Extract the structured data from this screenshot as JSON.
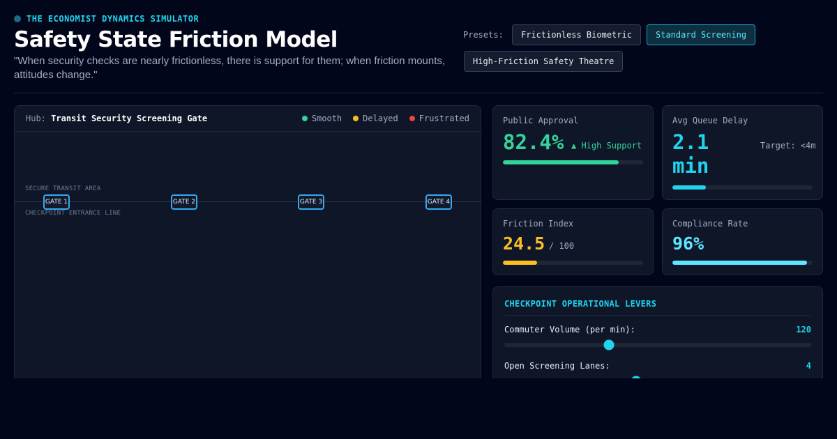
{
  "header": {
    "brand": "THE ECONOMIST DYNAMICS SIMULATOR",
    "title": "Safety State Friction Model",
    "quote": "\"When security checks are nearly frictionless, there is support for them; when friction mounts, attitudes change.\""
  },
  "presets": {
    "label": "Presets:",
    "items": [
      {
        "label": "Frictionless Biometric",
        "active": false
      },
      {
        "label": "Standard Screening",
        "active": true
      },
      {
        "label": "High-Friction Safety Theatre",
        "active": false
      }
    ]
  },
  "simulation": {
    "hub_prefix": "Hub:",
    "hub_name": "Transit Security Screening Gate",
    "legend": [
      {
        "label": "Smooth",
        "color": "#34d399"
      },
      {
        "label": "Delayed",
        "color": "#fbbf24"
      },
      {
        "label": "Frustrated",
        "color": "#ef4444"
      }
    ],
    "zone_top": "SECURE TRANSIT AREA",
    "zone_bottom": "CHECKPOINT ENTRANCE LINE",
    "gates": [
      "GATE 1",
      "GATE 2",
      "GATE 3",
      "GATE 4"
    ]
  },
  "metrics": {
    "approval": {
      "label": "Public Approval",
      "value": "82.4%",
      "aside": "▲ High Support",
      "fill": 0.824,
      "color": "#34d399"
    },
    "queue": {
      "label": "Avg Queue Delay",
      "value": "2.1 min",
      "aside": "Target: <4m",
      "fill": 0.24,
      "color": "#22d3ee"
    },
    "friction": {
      "label": "Friction Index",
      "value": "24.5",
      "aside": "/ 100",
      "fill": 0.245,
      "color": "#fbbf24"
    },
    "compliance": {
      "label": "Compliance Rate",
      "value": "96%",
      "fill": 0.96,
      "color": "#5ee7ff"
    }
  },
  "levers": {
    "title": "CHECKPOINT OPERATIONAL LEVERS",
    "items": [
      {
        "label": "Commuter Volume (per min):",
        "value": "120",
        "fraction": 0.34
      },
      {
        "label": "Open Screening Lanes:",
        "value": "4",
        "fraction": 0.43
      }
    ]
  }
}
